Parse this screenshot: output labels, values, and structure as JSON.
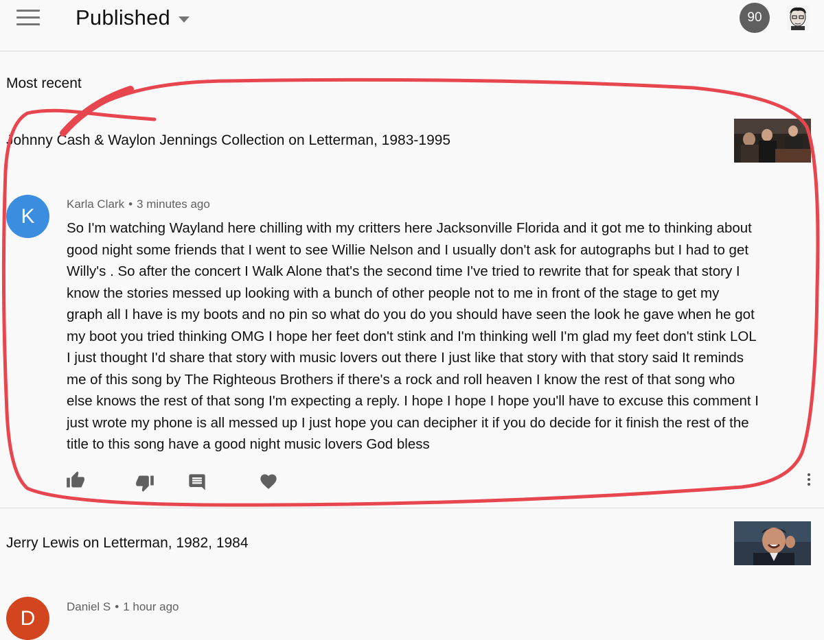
{
  "header": {
    "title": "Published",
    "notification_count": "90",
    "menu_icon": "hamburger-menu-icon",
    "dropdown_icon": "caret-down-icon"
  },
  "section": {
    "label": "Most recent"
  },
  "videos": [
    {
      "title": "Johnny Cash & Waylon Jennings Collection on Letterman, 1983-1995",
      "comment": {
        "avatar_letter": "K",
        "avatar_color": "#3b8de0",
        "author": "Karla Clark",
        "time": "3 minutes ago",
        "lines": [
          "So I'm watching Wayland here chilling with my critters here Jacksonville Florida and it got me to thinking about",
          "good night some friends that I went to see Willie Nelson and I usually don't ask for autographs but I had to get",
          "Willy's . So after the concert I Walk Alone that's the second time I've tried to rewrite that for speak that story I",
          "know the stories messed up looking with a bunch of other people not to me in front of the stage to get my",
          "graph all I have is my boots and no pin so what do you do you should have seen the look he gave when he got",
          "my boot you tried thinking OMG I hope her feet don't stink and I'm thinking well I'm glad my feet don't stink LOL",
          "I just thought I'd share that story with music lovers out there I just like that story with that story said It reminds",
          "me of this song by The Righteous Brothers if there's a rock and roll heaven I know the rest of that song who",
          "else knows the rest of that song I'm expecting a reply. I hope I hope I hope you'll have to excuse this comment I",
          "just wrote my phone is all messed up I just hope you can decipher it if you do decide for it finish the rest of the",
          "title to this song have a good night music lovers God bless"
        ]
      }
    },
    {
      "title": "Jerry Lewis on Letterman, 1982, 1984",
      "comment": {
        "avatar_letter": "D",
        "avatar_color": "#d2451e",
        "author": "Daniel S",
        "time": "1 hour ago"
      }
    }
  ],
  "actions": [
    "thumbs-up-icon",
    "thumbs-down-icon",
    "reply-icon",
    "heart-icon",
    "more-vert-icon"
  ],
  "colors": {
    "annotation": "#e8464f",
    "icon": "#606060",
    "badge": "#5f5f5f"
  }
}
